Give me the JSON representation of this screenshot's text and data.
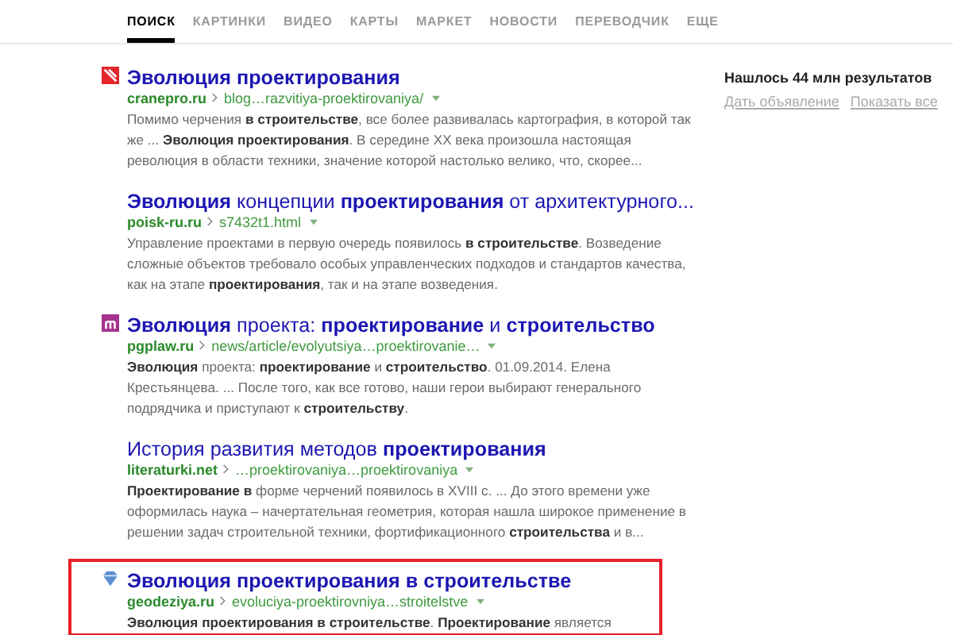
{
  "tabs": [
    {
      "label": "ПОИСК",
      "selected": true
    },
    {
      "label": "КАРТИНКИ",
      "selected": false
    },
    {
      "label": "ВИДЕО",
      "selected": false
    },
    {
      "label": "КАРТЫ",
      "selected": false
    },
    {
      "label": "МАРКЕТ",
      "selected": false
    },
    {
      "label": "НОВОСТИ",
      "selected": false
    },
    {
      "label": "ПЕРЕВОДЧИК",
      "selected": false
    },
    {
      "label": "ЕЩЕ",
      "selected": false
    }
  ],
  "results": [
    {
      "kind": "red-favicon",
      "title": "Эволюция проектирования",
      "title_bold": true,
      "domain": "cranepro.ru",
      "path": "blog…razvitiya-proektirovaniya/",
      "snippet": "Помимо черчения **в строительстве**, все более развивалась картография, в которой так же ... **Эволюция проектирования**. В середине XX века произошла настоящая революция в области техники, значение которой настолько велико, что, скорее...",
      "highlighted": false
    },
    {
      "kind": "plain",
      "title": "**Эволюция** концепции **проектирования** от архитектурного...",
      "title_bold": false,
      "domain": "poisk-ru.ru",
      "path": "s7432t1.html",
      "snippet": "Управление проектами в первую очередь появилось **в строительстве**. Возведение сложные объектов требовало особых управленческих подходов и стандартов качества, как на этапе **проектирования**, так и на этапе возведения.",
      "highlighted": false
    },
    {
      "kind": "purple-favicon",
      "title": "**Эволюция** проекта: **проектирование** и **строительство**",
      "title_bold": false,
      "domain": "pgplaw.ru",
      "path": "news/article/evolyutsiya…proektirovanie…",
      "snippet": "**Эволюция** проекта: **проектирование** и **строительство**. 01.09.2014. Елена Крестьянцева. ... После того, как все готово, наши герои выбирают генерального подрядчика и приступают к **строительству**.",
      "highlighted": false
    },
    {
      "kind": "plain",
      "title": "История развития методов **проектирования**",
      "title_bold": false,
      "domain": "literaturki.net",
      "path": "…proektirovaniya…proektirovaniya",
      "snippet": "**Проектирование в** форме черчений появилось в XVIII с. ... До этого времени уже оформилась наука – начертательная геометрия, которая нашла широкое применение в решении задач строительной техники, фортификационного **строительства** и в...",
      "highlighted": false
    },
    {
      "kind": "diamond-favicon",
      "title": "Эволюция проектирования в строительстве",
      "title_bold": true,
      "domain": "geodeziya.ru",
      "path": "evoluciya-proektirovniya…stroitelstve",
      "snippet": "**Эволюция проектирования в строительстве**. **Проектирование** является",
      "highlighted": true
    }
  ],
  "sidebar": {
    "count": "Нашлось 44 млн результатов",
    "links": [
      "Дать объявление",
      "Показать все"
    ]
  }
}
